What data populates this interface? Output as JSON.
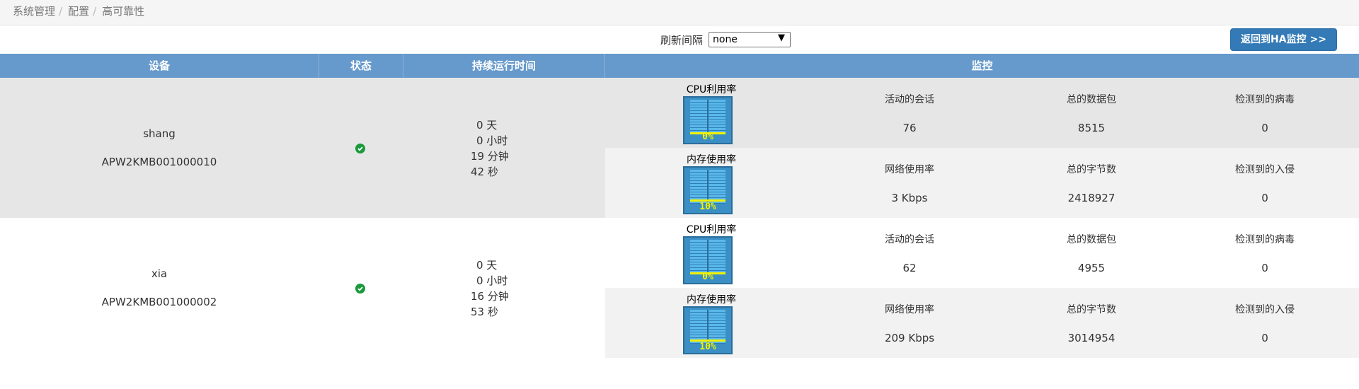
{
  "breadcrumb": [
    "系统管理",
    "配置",
    "高可靠性"
  ],
  "toolbar": {
    "refresh_label": "刷新间隔",
    "refresh_value": "none",
    "return_button": "返回到HA监控 >>"
  },
  "table_headers": [
    "设备",
    "状态",
    "持续运行时间",
    "监控"
  ],
  "monitor_labels": {
    "cpu": "CPU利用率",
    "memory": "内存使用率",
    "sessions": "活动的会话",
    "packets": "总的数据包",
    "viruses": "检测到的病毒",
    "network": "网络使用率",
    "bytes": "总的字节数",
    "intrusions": "检测到的入侵"
  },
  "devices": [
    {
      "name": "shang",
      "serial": "APW2KMB001000010",
      "status_icon": "check-circle-icon",
      "status_color": "#1a9a3c",
      "uptime": [
        "0 天",
        "0 小时",
        "19 分钟",
        "42 秒"
      ],
      "cpu_percent": "0%",
      "cpu_level": 0,
      "memory_percent": "10%",
      "memory_level": 0.1,
      "sessions": "76",
      "packets": "8515",
      "viruses": "0",
      "network": "3 Kbps",
      "bytes": "2418927",
      "intrusions": "0"
    },
    {
      "name": "xia",
      "serial": "APW2KMB001000002",
      "status_icon": "check-circle-icon",
      "status_color": "#1a9a3c",
      "uptime": [
        "0 天",
        "0 小时",
        "16 分钟",
        "53 秒"
      ],
      "cpu_percent": "0%",
      "cpu_level": 0,
      "memory_percent": "10%",
      "memory_level": 0.1,
      "sessions": "62",
      "packets": "4955",
      "viruses": "0",
      "network": "209 Kbps",
      "bytes": "3014954",
      "intrusions": "0"
    }
  ],
  "colors": {
    "header_bg": "#6699cc",
    "button_bg": "#337ab7",
    "gauge_yellow": "#f2f200"
  }
}
